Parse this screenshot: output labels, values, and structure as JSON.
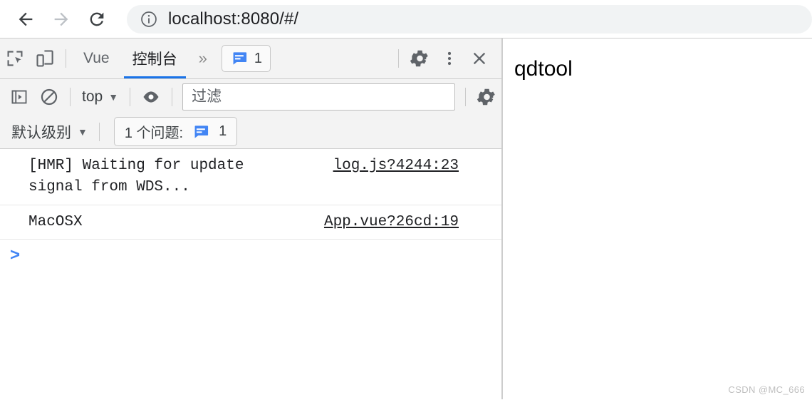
{
  "browser": {
    "back_icon": "arrow-left-icon",
    "forward_icon": "arrow-right-icon",
    "reload_icon": "reload-icon",
    "site_info_icon": "info-circle-icon",
    "url_host": "localhost:8080",
    "url_path": "/#/",
    "url_full": "localhost:8080/#/"
  },
  "devtools": {
    "inspect_icon": "inspect-element-icon",
    "device_toolbar_icon": "device-toolbar-icon",
    "tabs": [
      {
        "label": "Vue",
        "active": false
      },
      {
        "label": "控制台",
        "active": true
      }
    ],
    "more_tabs_label": "»",
    "message_badge": {
      "icon": "message-bubble-icon",
      "count": "1"
    },
    "settings_icon": "gear-icon",
    "menu_icon": "more-vertical-icon",
    "close_icon": "close-icon",
    "console_toolbar": {
      "sidebar_icon": "console-sidebar-icon",
      "clear_icon": "clear-console-icon",
      "context_label": "top",
      "context_caret": "▼",
      "eye_icon": "eye-icon",
      "filter_placeholder": "过滤",
      "filter_value": "",
      "settings_icon": "gear-icon"
    },
    "level_toolbar": {
      "level_label": "默认级别",
      "level_caret": "▼",
      "issues_label": "1 个问题:",
      "issues_icon": "message-bubble-icon",
      "issues_count": "1"
    },
    "messages": [
      {
        "text": "[HMR] Waiting for update signal from WDS...",
        "source": "log.js?4244:23"
      },
      {
        "text": "MacOSX",
        "source": "App.vue?26cd:19"
      }
    ],
    "prompt_symbol": ">"
  },
  "page": {
    "heading": "qdtool"
  },
  "watermark": "CSDN @MC_666",
  "colors": {
    "accent_blue": "#1a73e8",
    "icon_blue": "#4285f4",
    "toolbar_bg": "#f3f3f3",
    "omnibox_bg": "#f1f3f4",
    "border": "#cdcdcd"
  }
}
